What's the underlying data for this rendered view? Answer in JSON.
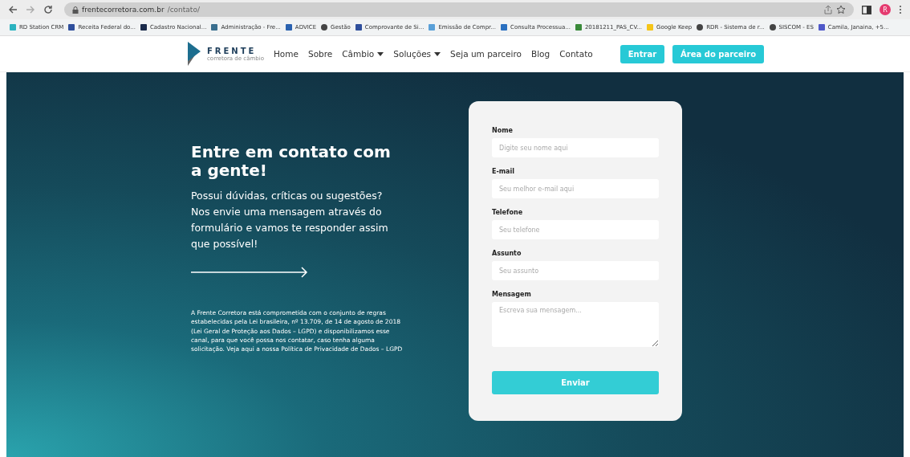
{
  "browser": {
    "url_host": "frentecorretora.com.br",
    "url_path": "/contato/",
    "profile_initial": "R",
    "bookmarks": [
      "RD Station CRM",
      "Receita Federal do...",
      "Cadastro Nacional...",
      "Administração - Fre...",
      "ADVICE",
      "Gestão",
      "Comprovante de Si...",
      "Emissão de Compr...",
      "Consulta Processua...",
      "20181211_PAS_CV...",
      "Google Keep",
      "RDR - Sistema de r...",
      "SISCOM - ES",
      "Camila, Janaina, +5..."
    ]
  },
  "nav": {
    "logo_name": "FRENTE",
    "logo_tagline": "corretora de câmbio",
    "links": [
      {
        "label": "Home",
        "dropdown": false
      },
      {
        "label": "Sobre",
        "dropdown": false
      },
      {
        "label": "Câmbio",
        "dropdown": true
      },
      {
        "label": "Soluções",
        "dropdown": true
      },
      {
        "label": "Seja um parceiro",
        "dropdown": false
      },
      {
        "label": "Blog",
        "dropdown": false
      },
      {
        "label": "Contato",
        "dropdown": false
      }
    ],
    "buttons": [
      "Entrar",
      "Área do parceiro"
    ]
  },
  "hero": {
    "heading": "Entre em contato com a gente!",
    "text": "Possui dúvidas, críticas ou sugestões? Nos envie uma mensagem através do formulário e vamos te responder assim que possível!",
    "legal": "A Frente Corretora está comprometida com o conjunto de regras estabelecidas pela Lei brasileira, nº 13.709, de 14 de agosto de 2018 (Lei Geral de Proteção aos Dados – LGPD) e disponibilizamos esse canal, para que você possa nos contatar, caso tenha alguma solicitação. Veja aqui a nossa Política de Privacidade de Dados – LGPD"
  },
  "form": {
    "fields": [
      {
        "label": "Nome",
        "placeholder": "Digite seu nome aqui",
        "kind": "input"
      },
      {
        "label": "E-mail",
        "placeholder": "Seu melhor e-mail aqui",
        "kind": "input"
      },
      {
        "label": "Telefone",
        "placeholder": "Seu telefone",
        "kind": "input"
      },
      {
        "label": "Assunto",
        "placeholder": "Seu assunto",
        "kind": "input"
      },
      {
        "label": "Mensagem",
        "placeholder": "Escreva sua mensagem...",
        "kind": "textarea"
      }
    ],
    "submit": "Enviar"
  }
}
